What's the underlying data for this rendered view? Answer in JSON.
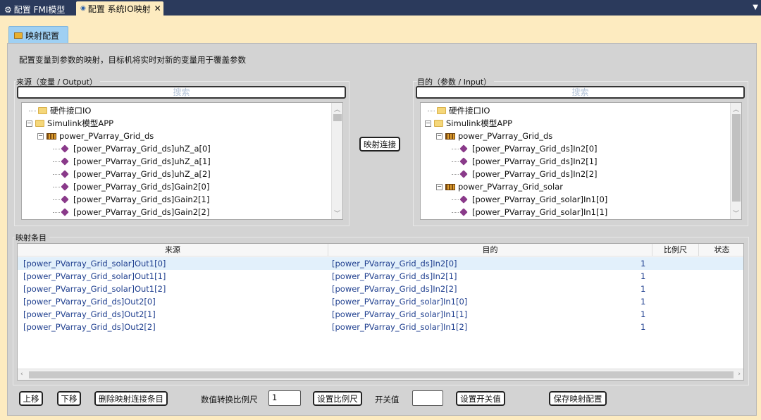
{
  "tabs": [
    {
      "label": "配置 FMI模型"
    },
    {
      "label": "配置 系统IO映射",
      "close": "✕"
    }
  ],
  "inner_tab": {
    "label": "映射配置"
  },
  "description": "配置变量到参数的映射，目标机将实时对新的变量用于覆盖参数",
  "source": {
    "title": "来源（变量 / Output）",
    "search_placeholder": "搜索",
    "items": [
      {
        "label": "硬件接口IO"
      },
      {
        "label": "Simulink模型APP"
      },
      {
        "label": "power_PVarray_Grid_ds"
      },
      {
        "label": "[power_PVarray_Grid_ds]uhZ_a[0]"
      },
      {
        "label": "[power_PVarray_Grid_ds]uhZ_a[1]"
      },
      {
        "label": "[power_PVarray_Grid_ds]uhZ_a[2]"
      },
      {
        "label": "[power_PVarray_Grid_ds]Gain2[0]"
      },
      {
        "label": "[power_PVarray_Grid_ds]Gain2[1]"
      },
      {
        "label": "[power_PVarray_Grid_ds]Gain2[2]"
      }
    ]
  },
  "target": {
    "title": "目的（参数 / Input）",
    "search_placeholder": "搜索",
    "items": [
      {
        "label": "硬件接口IO"
      },
      {
        "label": "Simulink模型APP"
      },
      {
        "label": "power_PVarray_Grid_ds"
      },
      {
        "label": "[power_PVarray_Grid_ds]In2[0]"
      },
      {
        "label": "[power_PVarray_Grid_ds]In2[1]"
      },
      {
        "label": "[power_PVarray_Grid_ds]In2[2]"
      },
      {
        "label": "power_PVarray_Grid_solar"
      },
      {
        "label": "[power_PVarray_Grid_solar]In1[0]"
      },
      {
        "label": "[power_PVarray_Grid_solar]In1[1]"
      }
    ]
  },
  "map_button": "映射连接",
  "entries": {
    "title": "映射条目",
    "columns": [
      "来源",
      "目的",
      "比例尺",
      "状态"
    ],
    "rows": [
      {
        "source": "[power_PVarray_Grid_solar]Out1[0]",
        "target": "[power_PVarray_Grid_ds]In2[0]",
        "scale": "1",
        "status": ""
      },
      {
        "source": "[power_PVarray_Grid_solar]Out1[1]",
        "target": "[power_PVarray_Grid_ds]In2[1]",
        "scale": "1",
        "status": ""
      },
      {
        "source": "[power_PVarray_Grid_solar]Out1[2]",
        "target": "[power_PVarray_Grid_ds]In2[2]",
        "scale": "1",
        "status": ""
      },
      {
        "source": "[power_PVarray_Grid_ds]Out2[0]",
        "target": "[power_PVarray_Grid_solar]In1[0]",
        "scale": "1",
        "status": ""
      },
      {
        "source": "[power_PVarray_Grid_ds]Out2[1]",
        "target": "[power_PVarray_Grid_solar]In1[1]",
        "scale": "1",
        "status": ""
      },
      {
        "source": "[power_PVarray_Grid_ds]Out2[2]",
        "target": "[power_PVarray_Grid_solar]In1[2]",
        "scale": "1",
        "status": ""
      }
    ]
  },
  "bottom": {
    "move_up": "上移",
    "move_down": "下移",
    "delete": "删除映射连接条目",
    "scale_label": "数值转换比例尺",
    "scale_value": "1",
    "set_scale": "设置比例尺",
    "switch_label": "开关值",
    "switch_value": "",
    "set_switch": "设置开关值",
    "save": "保存映射配置"
  }
}
